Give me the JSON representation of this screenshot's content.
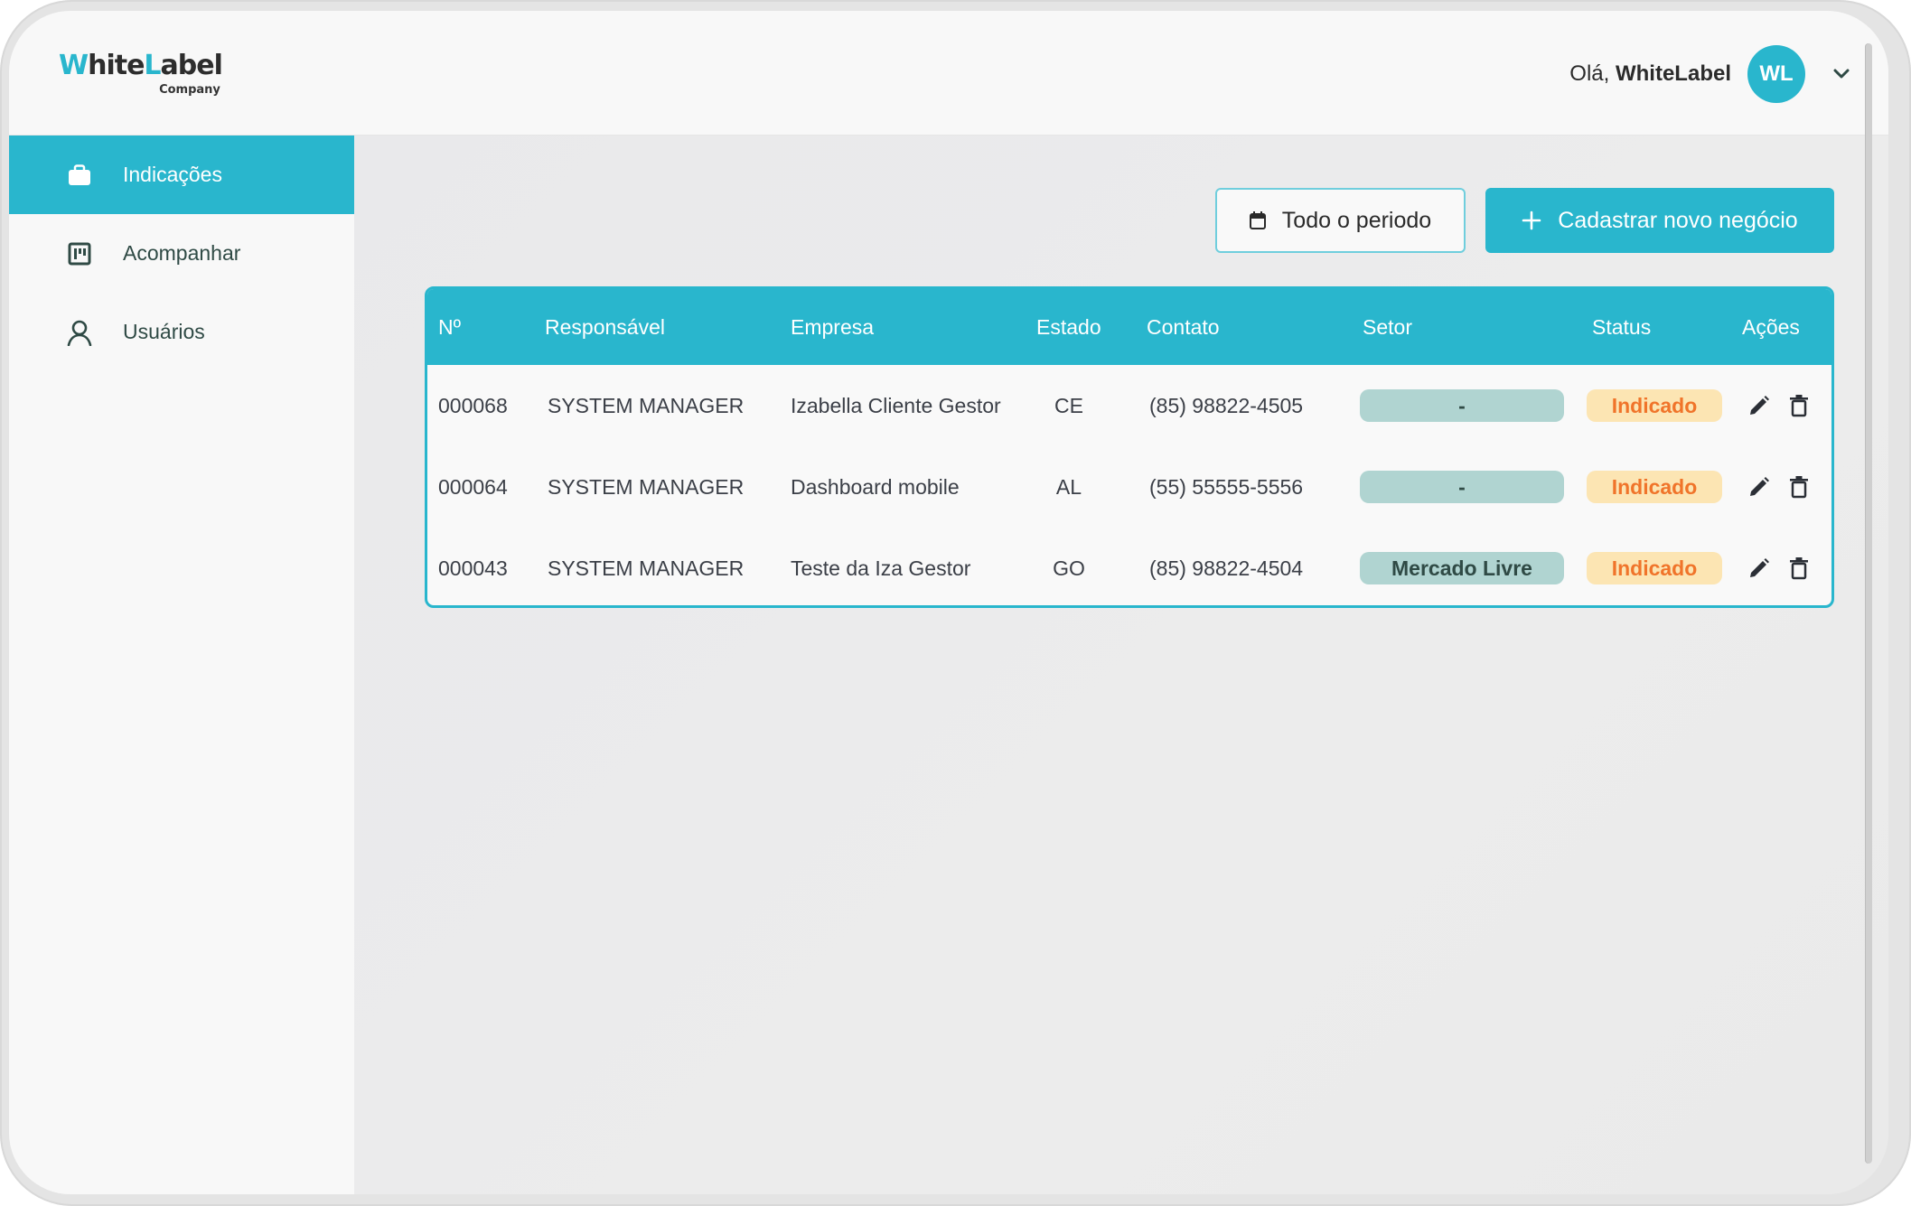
{
  "header": {
    "logo": {
      "part1_accent": "W",
      "part1": "hite",
      "part2_accent": "L",
      "part2": "abel",
      "subtitle": "Company"
    },
    "greeting_prefix": "Olá,",
    "user_name": "WhiteLabel",
    "avatar_initials": "WL",
    "dropdown_icon": "chevron-down-icon"
  },
  "sidebar": {
    "items": [
      {
        "label": "Indicações",
        "icon": "briefcase-icon",
        "active": true
      },
      {
        "label": "Acompanhar",
        "icon": "kanban-board-icon",
        "active": false
      },
      {
        "label": "Usuários",
        "icon": "user-icon",
        "active": false
      }
    ]
  },
  "toolbar": {
    "period_button": {
      "label": "Todo o periodo",
      "icon": "calendar-icon"
    },
    "new_button": {
      "label": "Cadastrar novo negócio",
      "icon": "plus-icon"
    }
  },
  "table": {
    "columns": [
      "Nº",
      "Responsável",
      "Empresa",
      "Estado",
      "Contato",
      "Setor",
      "Status",
      "Ações"
    ],
    "rows": [
      {
        "id": "000068",
        "responsavel": "SYSTEM MANAGER",
        "empresa": "Izabella Cliente Gestor",
        "estado": "CE",
        "contato": "(85) 98822-4505",
        "setor": "-",
        "status": "Indicado"
      },
      {
        "id": "000064",
        "responsavel": "SYSTEM MANAGER",
        "empresa": "Dashboard mobile",
        "estado": "AL",
        "contato": "(55) 55555-5556",
        "setor": "-",
        "status": "Indicado"
      },
      {
        "id": "000043",
        "responsavel": "SYSTEM MANAGER",
        "empresa": "Teste da Iza Gestor",
        "estado": "GO",
        "contato": "(85) 98822-4504",
        "setor": "Mercado Livre",
        "status": "Indicado"
      }
    ],
    "row_actions": [
      "edit-icon",
      "trash-icon"
    ]
  },
  "colors": {
    "brand": "#29b6cd",
    "sector_pill_bg": "#b0d4d1",
    "status_pill_bg": "#fce5b3",
    "status_pill_text": "#f0742a",
    "sidebar_text": "#2f4a45"
  }
}
